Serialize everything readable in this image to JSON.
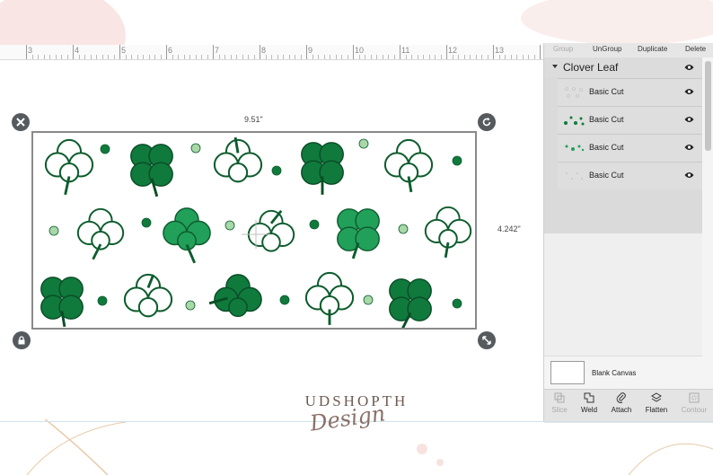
{
  "ruler": {
    "numbers": [
      "3",
      "4",
      "5",
      "6",
      "7",
      "8",
      "9",
      "10",
      "11",
      "12",
      "13"
    ]
  },
  "canvas": {
    "width_label": "9.51\"",
    "height_label": "4.242\""
  },
  "panel": {
    "top_actions": [
      {
        "label": "Group",
        "enabled": false
      },
      {
        "label": "UnGroup",
        "enabled": true
      },
      {
        "label": "Duplicate",
        "enabled": true
      },
      {
        "label": "Delete",
        "enabled": true
      }
    ],
    "group_name": "Clover Leaf",
    "layers": [
      {
        "label": "Basic Cut",
        "icon": "layer-thumbnail-icon"
      },
      {
        "label": "Basic Cut",
        "icon": "layer-thumbnail-icon"
      },
      {
        "label": "Basic Cut",
        "icon": "layer-thumbnail-icon"
      },
      {
        "label": "Basic Cut",
        "icon": "layer-thumbnail-icon"
      }
    ],
    "blank_canvas": "Blank Canvas",
    "tools": [
      {
        "label": "Slice",
        "enabled": false,
        "icon": "slice-icon"
      },
      {
        "label": "Weld",
        "enabled": true,
        "icon": "weld-icon"
      },
      {
        "label": "Attach",
        "enabled": true,
        "icon": "attach-icon"
      },
      {
        "label": "Flatten",
        "enabled": true,
        "icon": "flatten-icon"
      },
      {
        "label": "Contour",
        "enabled": false,
        "icon": "contour-icon"
      }
    ]
  },
  "watermark": {
    "line1": "UDSHOPTH",
    "line2": "Design"
  },
  "colors": {
    "dark_green": "#0f7a3c",
    "mid_green": "#21a05a",
    "light_green": "#a8d8a8",
    "outline": "#0d5c2d"
  }
}
